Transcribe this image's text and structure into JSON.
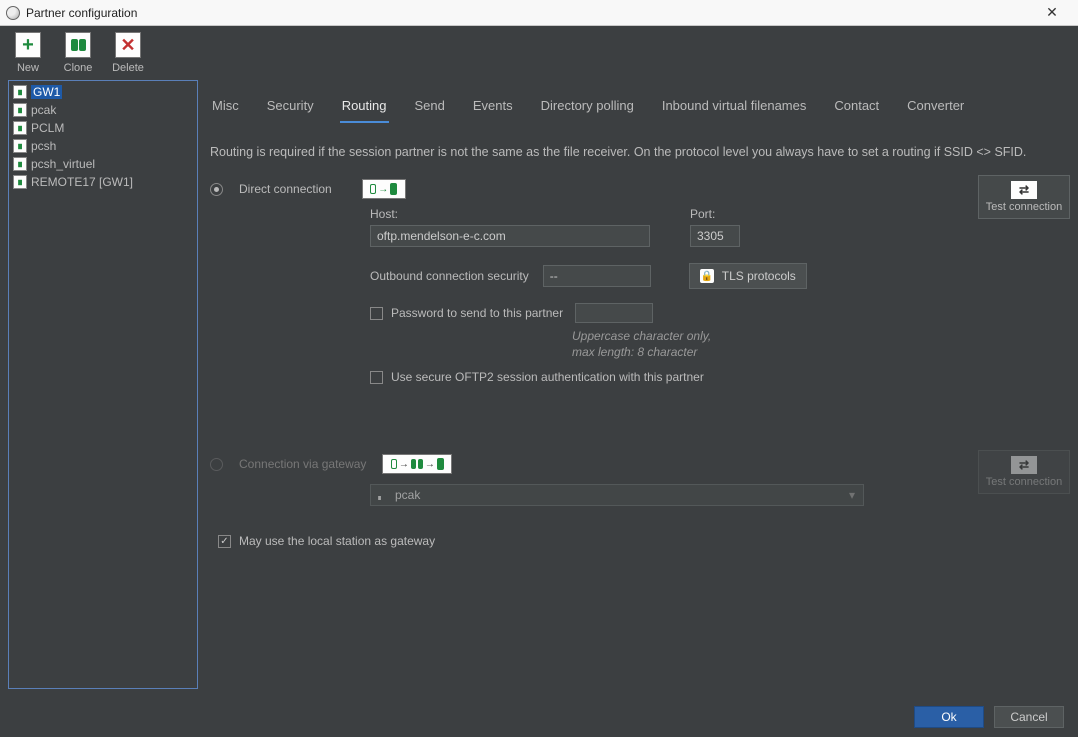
{
  "window": {
    "title": "Partner configuration"
  },
  "toolbar": {
    "new_label": "New",
    "clone_label": "Clone",
    "delete_label": "Delete"
  },
  "sidebar": {
    "items": [
      {
        "label": "GW1",
        "selected": true
      },
      {
        "label": "pcak",
        "selected": false
      },
      {
        "label": "PCLM",
        "selected": false
      },
      {
        "label": "pcsh",
        "selected": false
      },
      {
        "label": "pcsh_virtuel",
        "selected": false
      },
      {
        "label": "REMOTE17 [GW1]",
        "selected": false
      }
    ]
  },
  "tabs": {
    "items": [
      {
        "label": "Misc"
      },
      {
        "label": "Security"
      },
      {
        "label": "Routing",
        "active": true
      },
      {
        "label": "Send"
      },
      {
        "label": "Events"
      },
      {
        "label": "Directory polling"
      },
      {
        "label": "Inbound virtual filenames"
      },
      {
        "label": "Contact"
      },
      {
        "label": "Converter"
      }
    ]
  },
  "description": "Routing is required if the session partner is not the same as the file receiver. On the protocol level you always have to set a routing if SSID <> SFID.",
  "direct": {
    "radio_label": "Direct connection",
    "host_label": "Host:",
    "host_value": "oftp.mendelson-e-c.com",
    "port_label": "Port:",
    "port_value": "3305",
    "out_sec_label": "Outbound connection security",
    "out_sec_value": "--",
    "tls_button": "TLS protocols",
    "pw_checkbox_label": "Password to send to this partner",
    "pw_hint_line1": "Uppercase character only,",
    "pw_hint_line2": "max length: 8 character",
    "secure_session_label": "Use secure OFTP2 session authentication with this partner",
    "test_button": "Test connection"
  },
  "gateway": {
    "radio_label": "Connection via gateway",
    "selected_value": "pcak",
    "test_button": "Test connection"
  },
  "may_gateway_label": "May use the local station as gateway",
  "footer": {
    "ok": "Ok",
    "cancel": "Cancel"
  }
}
